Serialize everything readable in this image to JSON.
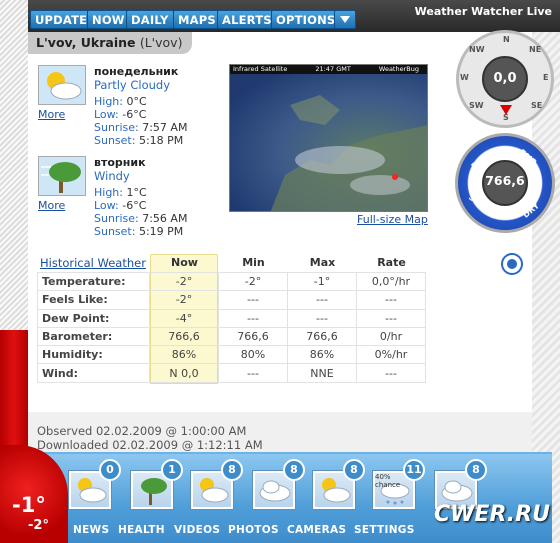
{
  "app": {
    "brand": "Weather Watcher Live",
    "location": "L'vov, Ukraine",
    "location_alt": "(L'vov)"
  },
  "toolbar": [
    "UPDATE",
    "NOW",
    "DAILY",
    "MAPS",
    "ALERTS",
    "OPTIONS"
  ],
  "forecast_days": [
    {
      "name": "понедельник",
      "condition": "Partly Cloudy",
      "high": "0°C",
      "low": "-6°C",
      "sunrise": "7:57 AM",
      "sunset": "5:18 PM",
      "more": "More",
      "icon": "partly-cloudy-icon"
    },
    {
      "name": "вторник",
      "condition": "Windy",
      "high": "1°C",
      "low": "-6°C",
      "sunrise": "7:56 AM",
      "sunset": "5:19 PM",
      "more": "More",
      "icon": "windy-tree-icon"
    }
  ],
  "labels": {
    "high": "High:",
    "low": "Low:",
    "sunrise": "Sunrise:",
    "sunset": "Sunset:"
  },
  "satellite": {
    "title": "Infrared Satellite",
    "time": "21:47 GMT",
    "brand": "WeatherBug",
    "link": "Full-size Map"
  },
  "table": {
    "link": "Historical Weather",
    "headers": [
      "Now",
      "Min",
      "Max",
      "Rate"
    ],
    "rows": [
      {
        "label": "Temperature:",
        "now": "-2°",
        "min": "-2°",
        "max": "-1°",
        "rate": "0,0°/hr"
      },
      {
        "label": "Feels Like:",
        "now": "-2°",
        "min": "---",
        "max": "---",
        "rate": "---"
      },
      {
        "label": "Dew Point:",
        "now": "-4°",
        "min": "---",
        "max": "---",
        "rate": "---"
      },
      {
        "label": "Barometer:",
        "now": "766,6",
        "min": "766,6",
        "max": "766,6",
        "rate": "0/hr"
      },
      {
        "label": "Humidity:",
        "now": "86%",
        "min": "80%",
        "max": "86%",
        "rate": "0%/hr"
      },
      {
        "label": "Wind:",
        "now": "N 0,0",
        "min": "---",
        "max": "NNE",
        "rate": "---"
      }
    ]
  },
  "observed": "Observed 02.02.2009 @ 1:00:00 AM",
  "downloaded": "Downloaded 02.02.2009 @ 1:12:11 AM",
  "compass": {
    "value": "0,0",
    "labels": [
      "N",
      "NE",
      "E",
      "SE",
      "S",
      "SW",
      "W",
      "NW"
    ]
  },
  "barometer": {
    "value": "766,6",
    "labels": [
      "RAIN",
      "FAIR",
      "STORM",
      "DRY"
    ]
  },
  "thermometer": {
    "temp": "-1°",
    "feels": "-2°"
  },
  "forecast_strip": [
    {
      "badge": "0",
      "icon": "partly-cloudy-icon"
    },
    {
      "badge": "1",
      "icon": "windy-tree-icon"
    },
    {
      "badge": "8",
      "icon": "partly-cloudy-icon"
    },
    {
      "badge": "8",
      "icon": "cloudy-icon"
    },
    {
      "badge": "8",
      "icon": "partly-cloudy-icon"
    },
    {
      "badge": "11",
      "icon": "snow-icon",
      "chance": "40% chance"
    },
    {
      "badge": "8",
      "icon": "cloudy-icon"
    }
  ],
  "bottom_nav": [
    "NEWS",
    "HEALTH",
    "VIDEOS",
    "PHOTOS",
    "CAMERAS",
    "SETTINGS"
  ],
  "watermark": "CWER.RU",
  "colors": {
    "accent": "#2a6bbd",
    "thermometer": "#d00000",
    "strip": "#4f9ed8"
  }
}
